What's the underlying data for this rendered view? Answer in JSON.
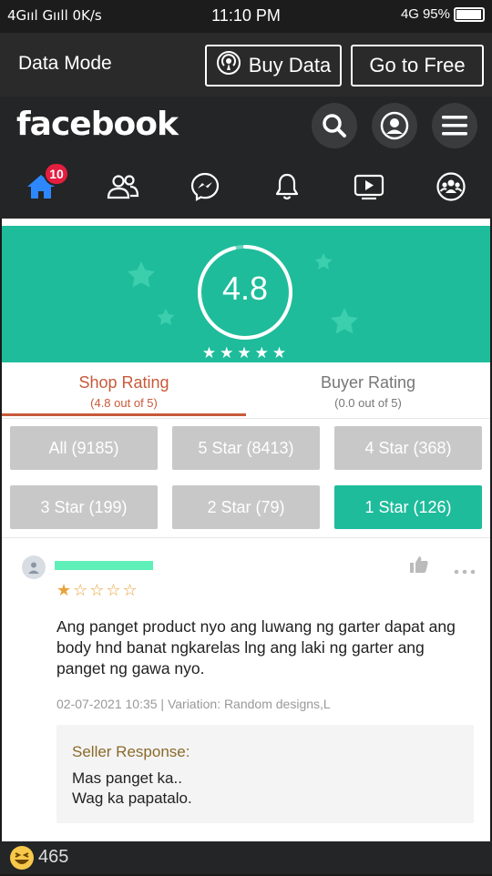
{
  "status_bar": {
    "left": "4Gııl Gııll 0K/s",
    "time": "11:10 PM",
    "network": "4G",
    "battery": "95%",
    "battery_fraction": 0.95
  },
  "data_mode": {
    "label": "Data Mode",
    "buy_data": "Buy Data",
    "go_free": "Go to Free"
  },
  "facebook": {
    "logo": "facebook",
    "home_badge": "10",
    "nav": [
      "home-icon",
      "friends-icon",
      "messenger-icon",
      "notifications-icon",
      "watch-icon",
      "groups-icon"
    ]
  },
  "shop": {
    "rating": "4.8",
    "hero_stars": "★★★★★",
    "tabs": [
      {
        "title": "Shop Rating",
        "sub": "(4.8 out of 5)"
      },
      {
        "title": "Buyer Rating",
        "sub": "(0.0 out of 5)"
      }
    ],
    "filters": [
      "All (9185)",
      "5 Star (8413)",
      "4 Star (368)",
      "3 Star (199)",
      "2 Star (79)",
      "1 Star (126)"
    ]
  },
  "review": {
    "stars": "★☆☆☆☆",
    "text": "Ang panget product nyo ang luwang ng garter dapat ang body hnd banat ngkarelas lng ang laki ng garter ang panget ng gawa nyo.",
    "meta": "02-07-2021 10:35 | Variation: Random designs,L",
    "seller_title": "Seller Response:",
    "seller_line1": "Mas panget ka..",
    "seller_line2": "Wag ka papatalo."
  },
  "reactions": {
    "count": "465"
  },
  "colors": {
    "teal": "#1ebc9b",
    "fb_bg": "#242526",
    "badge_red": "#e41e3f",
    "tab_active": "#c85a3a"
  }
}
